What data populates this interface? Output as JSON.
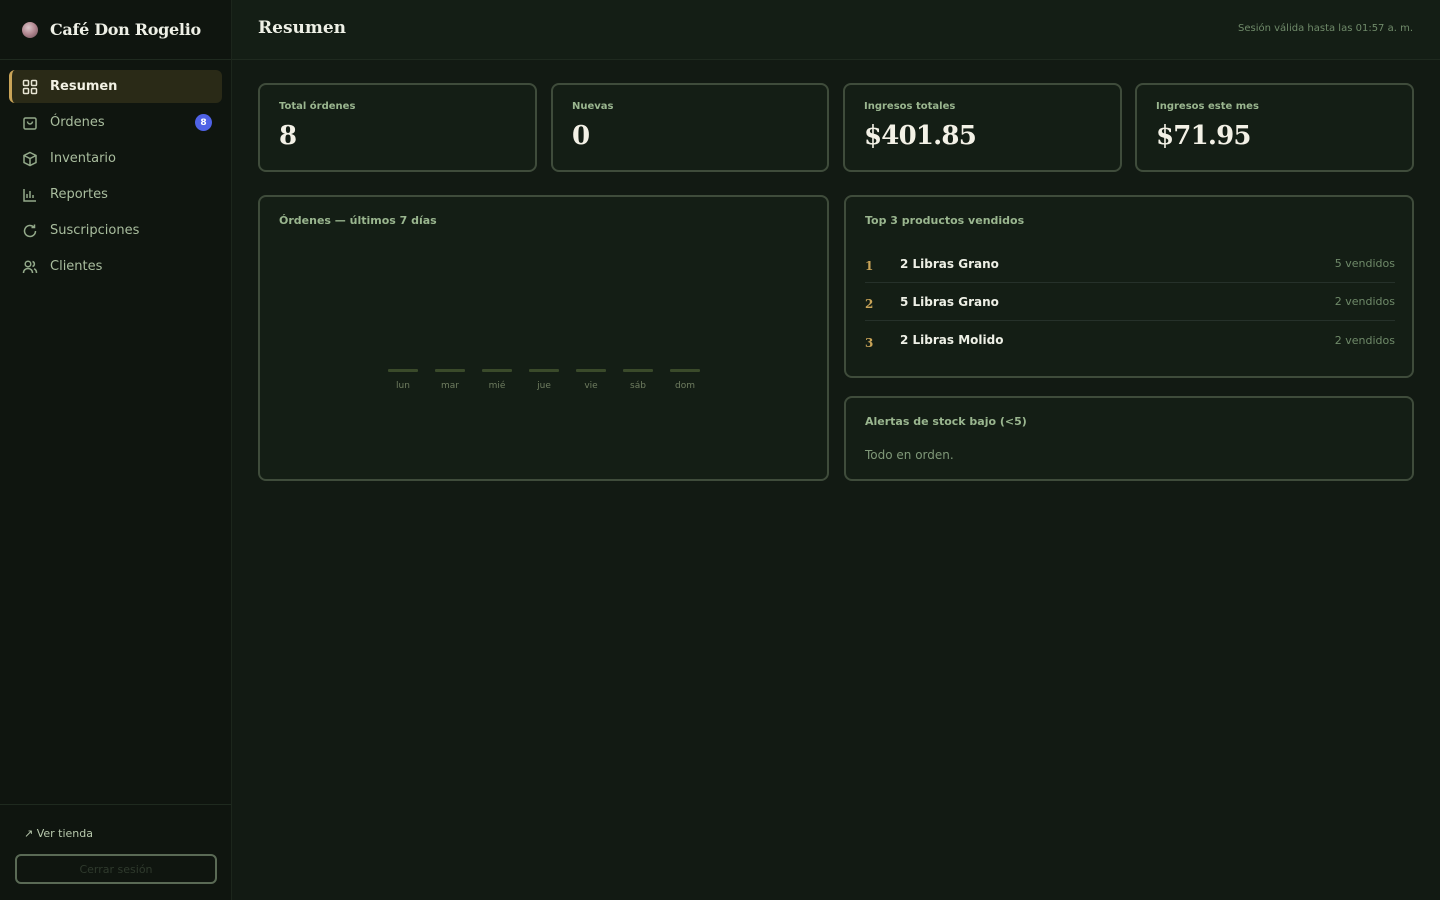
{
  "brand": {
    "name": "Café Don Rogelio"
  },
  "nav": [
    {
      "label": "Resumen",
      "icon": "grid-icon",
      "active": true
    },
    {
      "label": "Órdenes",
      "icon": "bag-icon",
      "badge": "8"
    },
    {
      "label": "Inventario",
      "icon": "box-icon"
    },
    {
      "label": "Reportes",
      "icon": "chart-icon"
    },
    {
      "label": "Suscripciones",
      "icon": "refresh-icon"
    },
    {
      "label": "Clientes",
      "icon": "users-icon"
    }
  ],
  "footer": {
    "store_link": "↗ Ver tienda",
    "logout": "Cerrar sesión"
  },
  "header": {
    "title": "Resumen",
    "session": "Sesión válida hasta las 01:57 a. m."
  },
  "stats": [
    {
      "label": "Total órdenes",
      "value": "8"
    },
    {
      "label": "Nuevas",
      "value": "0"
    },
    {
      "label": "Ingresos totales",
      "value": "$401.85"
    },
    {
      "label": "Ingresos este mes",
      "value": "$71.95"
    }
  ],
  "orders_chart": {
    "title": "Órdenes — últimos 7 días"
  },
  "top_products": {
    "title": "Top 3 productos vendidos",
    "items": [
      {
        "rank": "1",
        "name": "2 Libras Grano",
        "sold": "5 vendidos"
      },
      {
        "rank": "2",
        "name": "5 Libras Grano",
        "sold": "2 vendidos"
      },
      {
        "rank": "3",
        "name": "2 Libras Molido",
        "sold": "2 vendidos"
      }
    ]
  },
  "stock_alerts": {
    "title": "Alertas de stock bajo (<5)",
    "message": "Todo en orden."
  },
  "colors": {
    "accent": "#c9a458",
    "badge": "#4f62e6",
    "bar": "#3a4a2a"
  },
  "chart_data": {
    "type": "bar",
    "title": "Órdenes — últimos 7 días",
    "categories": [
      "lun",
      "mar",
      "mié",
      "jue",
      "vie",
      "sáb",
      "dom"
    ],
    "values": [
      0,
      0,
      0,
      0,
      0,
      0,
      0
    ],
    "xlabel": "",
    "ylabel": "",
    "grid": false
  }
}
